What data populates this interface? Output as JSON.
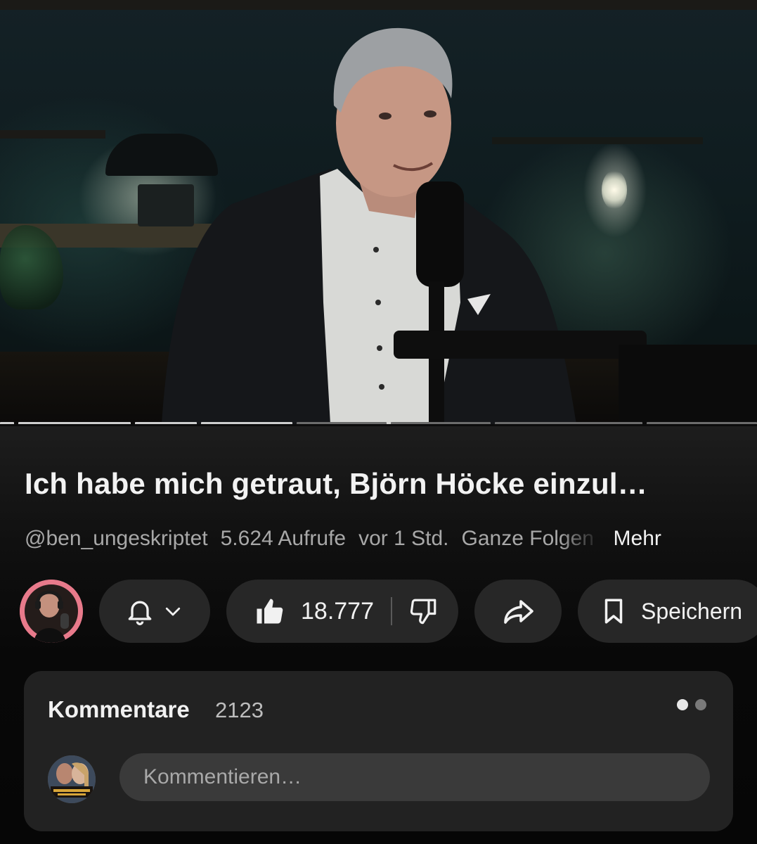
{
  "video": {
    "chapter_colors": [
      "#cfcfcf",
      "#cfcfcf",
      "#cfcfcf",
      "#cfcfcf",
      "#6c6c6c",
      "#6c6c6c",
      "#6c6c6c",
      "#6c6c6c"
    ]
  },
  "title": "Ich habe mich getraut, Björn Höcke einzul…",
  "meta": {
    "channel": "@ben_ungeskriptet",
    "views": "5.624 Aufrufe",
    "time": "vor 1 Std.",
    "playlist": "Ganze Folgen",
    "more": "Mehr"
  },
  "actions": {
    "subscribe_icon": "bell-icon",
    "like_count": "18.777",
    "save_label": "Speichern"
  },
  "comments": {
    "title": "Kommentare",
    "count": "2123",
    "input_placeholder": "Kommentieren…",
    "indicator_colors": [
      "#e8e8e8",
      "#7a7a7a"
    ]
  },
  "colors": {
    "background": "#0c0c0c",
    "pill": "#272727",
    "card": "#222222",
    "text_secondary": "#a8a8a8"
  }
}
